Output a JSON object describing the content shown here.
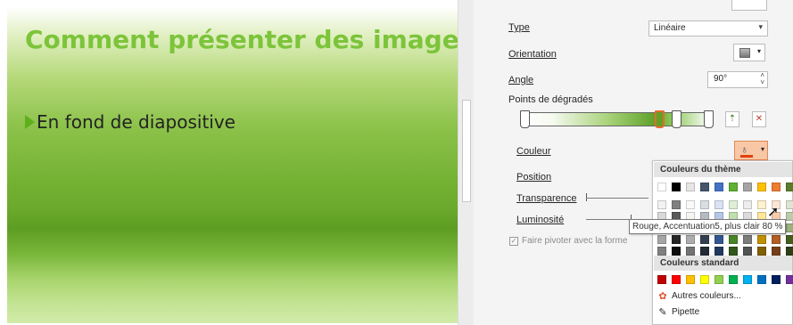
{
  "slide": {
    "title": "Comment présenter des images",
    "bullet": "En fond de diapositive"
  },
  "pane": {
    "type_label": "Type",
    "type_value": "Linéaire",
    "orientation_label": "Orientation",
    "angle_label": "Angle",
    "angle_value": "90°",
    "gradient_stops_label": "Points de dégradés",
    "color_label": "Couleur",
    "position_label": "Position",
    "transparency_label": "Transparence",
    "luminosity_label": "Luminosité",
    "rotate_with_shape_label": "Faire pivoter avec la forme",
    "accent_color": "#e56b2b"
  },
  "palette": {
    "theme_header": "Couleurs du thème",
    "standard_header": "Couleurs standard",
    "more_colors": "Autres couleurs...",
    "eyedropper": "Pipette",
    "theme_colors": [
      "#ffffff",
      "#000000",
      "#e7e6e6",
      "#44546a",
      "#4472c4",
      "#5fb033",
      "#a5a5a5",
      "#ffc000",
      "#ed7d31",
      "#5a7d2a"
    ],
    "standard_colors": [
      "#c00000",
      "#ff0000",
      "#ffc000",
      "#ffff00",
      "#92d050",
      "#00b050",
      "#00b0f0",
      "#0070c0",
      "#002060",
      "#7030a0"
    ],
    "tooltip": "Rouge, Accentuation5, plus clair 80 %"
  }
}
